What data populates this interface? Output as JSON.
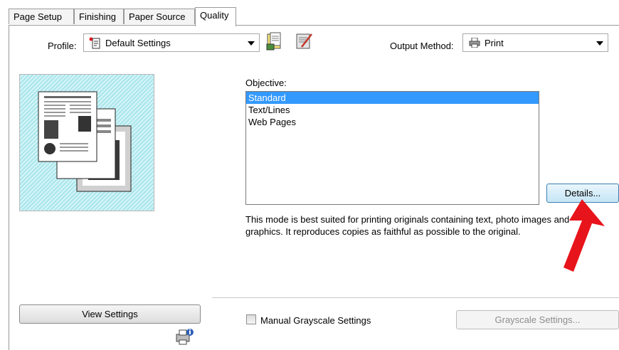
{
  "tabs": [
    {
      "label": "Page Setup"
    },
    {
      "label": "Finishing"
    },
    {
      "label": "Paper Source"
    },
    {
      "label": "Quality"
    }
  ],
  "profile": {
    "label": "Profile:",
    "value": "Default Settings"
  },
  "output_method": {
    "label": "Output Method:",
    "value": "Print"
  },
  "objective": {
    "label": "Objective:",
    "options": [
      "Standard",
      "Text/Lines",
      "Web Pages"
    ],
    "selected": "Standard"
  },
  "details_button": "Details...",
  "description": "This mode is best suited for printing originals containing text, photo images and graphics. It reproduces copies as faithful as possible to the original.",
  "view_settings_button": "View Settings",
  "manual_grayscale": {
    "label": "Manual Grayscale Settings",
    "checked": false
  },
  "grayscale_settings_button": "Grayscale Settings...",
  "colors": {
    "selection": "#3399ff",
    "annotation_arrow": "#e8141b"
  }
}
